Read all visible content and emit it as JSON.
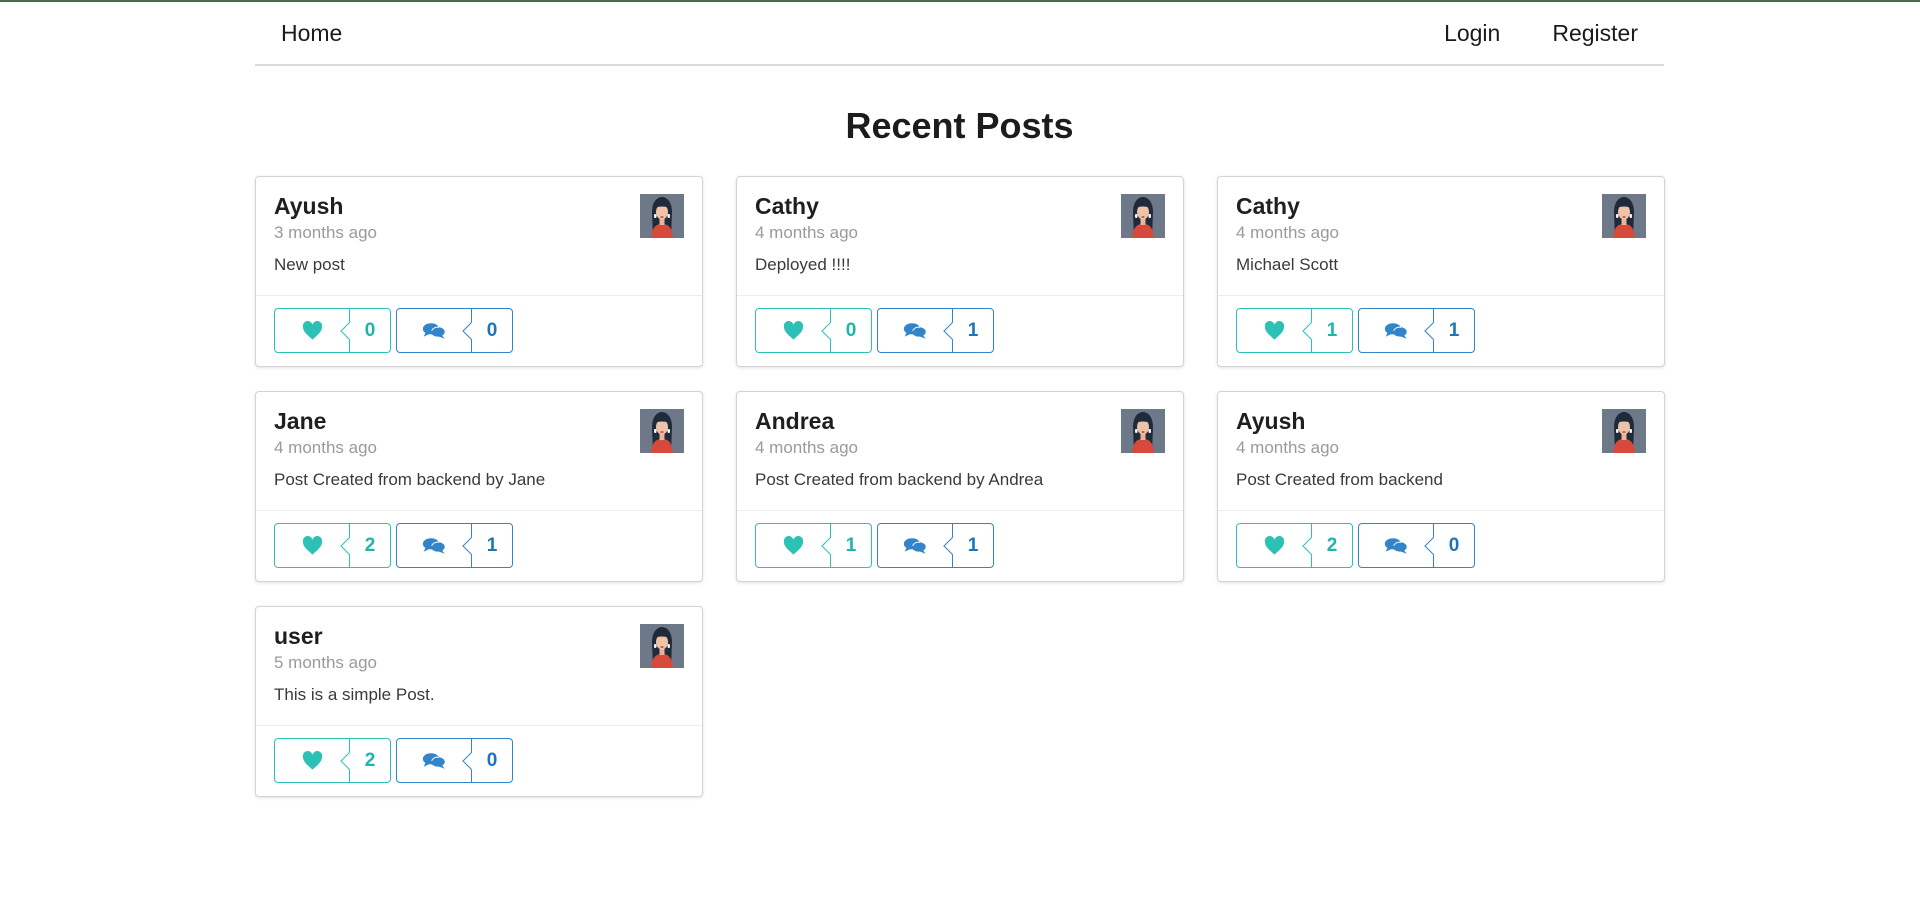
{
  "nav": {
    "home": "Home",
    "login": "Login",
    "register": "Register"
  },
  "page": {
    "title": "Recent Posts"
  },
  "colors": {
    "like": "#2dc1b5",
    "comment": "#3185c8",
    "top_bar": "#4b6b4f"
  },
  "icons": {
    "like": "heart-icon",
    "comment": "comments-icon",
    "avatar": "avatar-image"
  },
  "posts": [
    {
      "author": "Ayush",
      "time": "3 months ago",
      "body": "New post",
      "likes": "0",
      "comments": "0"
    },
    {
      "author": "Cathy",
      "time": "4 months ago",
      "body": "Deployed !!!!",
      "likes": "0",
      "comments": "1"
    },
    {
      "author": "Cathy",
      "time": "4 months ago",
      "body": "Michael Scott",
      "likes": "1",
      "comments": "1"
    },
    {
      "author": "Jane",
      "time": "4 months ago",
      "body": "Post Created from backend by Jane",
      "likes": "2",
      "comments": "1"
    },
    {
      "author": "Andrea",
      "time": "4 months ago",
      "body": "Post Created from backend by Andrea",
      "likes": "1",
      "comments": "1"
    },
    {
      "author": "Ayush",
      "time": "4 months ago",
      "body": "Post Created from backend",
      "likes": "2",
      "comments": "0"
    },
    {
      "author": "user",
      "time": "5 months ago",
      "body": "This is a simple Post.",
      "likes": "2",
      "comments": "0"
    }
  ]
}
